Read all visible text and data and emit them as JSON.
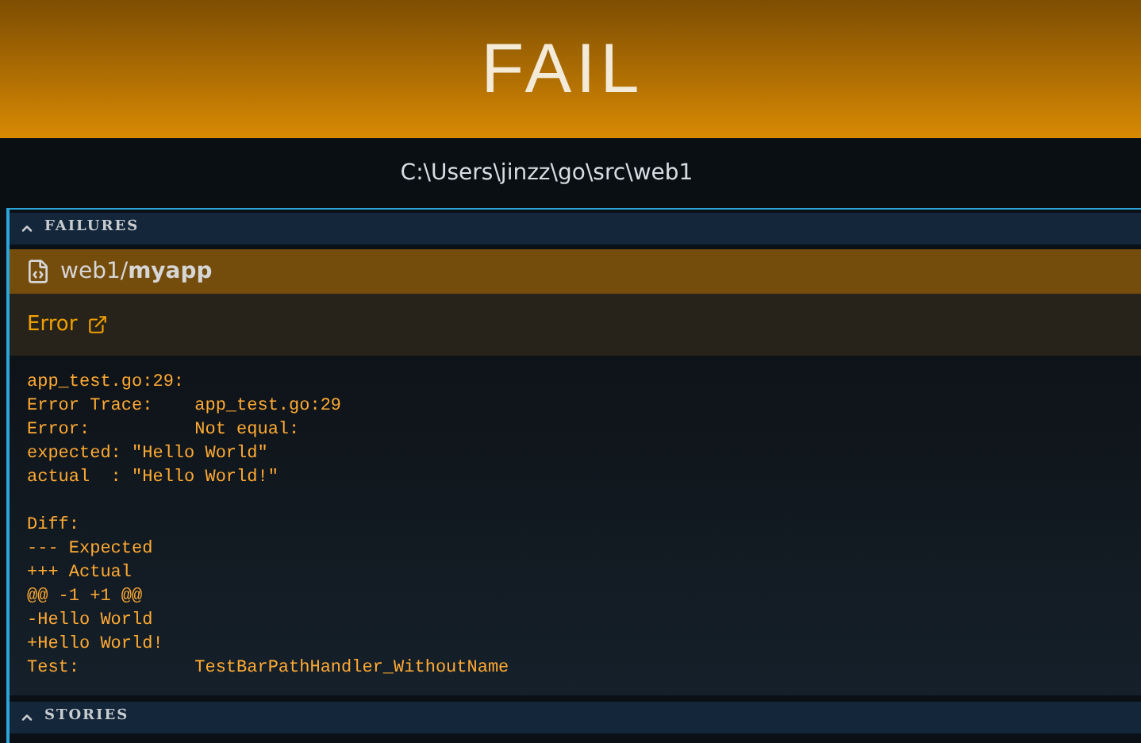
{
  "banner": {
    "status": "FAIL"
  },
  "path": "C:\\Users\\jinzz\\go\\src\\web1",
  "sections": [
    {
      "title": "FAILURES",
      "expanded": true,
      "package": "web1/**myapp**",
      "error_label": "Error",
      "output_blocks": [
        [
          "app_test.go:29:",
          "Error Trace:    app_test.go:29",
          "Error:          Not equal:",
          "expected: \"Hello World\"",
          "actual  : \"Hello World!\""
        ],
        [
          "Diff:",
          "--- Expected",
          "+++ Actual",
          "@@ -1 +1 @@",
          "-Hello World",
          "+Hello World!",
          "Test:           TestBarPathHandler_WithoutName"
        ]
      ]
    },
    {
      "title": "STORIES",
      "expanded": true
    }
  ]
}
